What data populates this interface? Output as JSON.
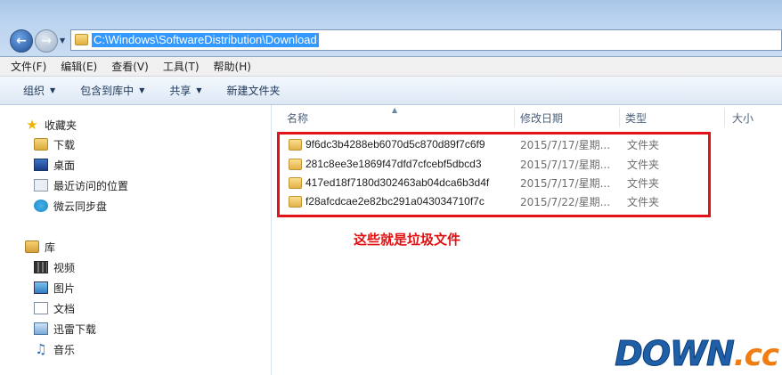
{
  "address_bar": {
    "path": "C:\\Windows\\SoftwareDistribution\\Download"
  },
  "menu": [
    "文件(F)",
    "编辑(E)",
    "查看(V)",
    "工具(T)",
    "帮助(H)"
  ],
  "toolbar": {
    "organize": "组织",
    "include_library": "包含到库中",
    "share": "共享",
    "new_folder": "新建文件夹"
  },
  "nav": {
    "favorites": {
      "label": "收藏夹",
      "items": [
        "下载",
        "桌面",
        "最近访问的位置",
        "微云同步盘"
      ]
    },
    "libraries": {
      "label": "库",
      "items": [
        "视频",
        "图片",
        "文档",
        "迅雷下载",
        "音乐"
      ]
    }
  },
  "columns": {
    "name": "名称",
    "date": "修改日期",
    "type": "类型",
    "size": "大小"
  },
  "files": [
    {
      "name": "9f6dc3b4288eb6070d5c870d89f7c6f9",
      "date": "2015/7/17/星期...",
      "type": "文件夹"
    },
    {
      "name": "281c8ee3e1869f47dfd7cfcebf5dbcd3",
      "date": "2015/7/17/星期...",
      "type": "文件夹"
    },
    {
      "name": "417ed18f7180d302463ab04dca6b3d4f",
      "date": "2015/7/17/星期...",
      "type": "文件夹"
    },
    {
      "name": "f28afcdcae2e82bc291a043034710f7c",
      "date": "2015/7/22/星期...",
      "type": "文件夹"
    }
  ],
  "annotation": "这些就是垃圾文件",
  "watermark": {
    "main": "DOWN",
    "tld": ".cc"
  },
  "colors": {
    "highlight_box": "#e0131b",
    "annotation_text": "#e01010",
    "selection": "#3399ff"
  }
}
